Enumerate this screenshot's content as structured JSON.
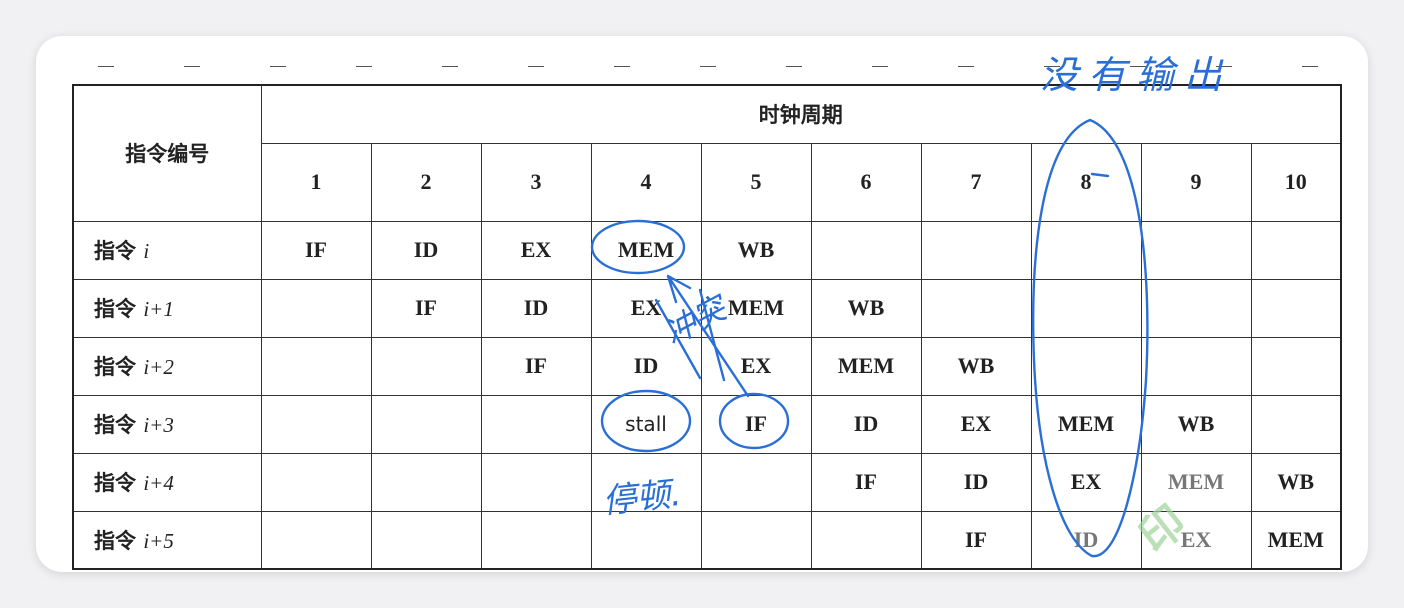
{
  "table": {
    "corner_label": "指令编号",
    "group_label": "时钟周期",
    "cycles": [
      "1",
      "2",
      "3",
      "4",
      "5",
      "6",
      "7",
      "8",
      "9",
      "10"
    ],
    "rows": [
      {
        "label_prefix": "指令 ",
        "label_var": "i",
        "cells": [
          "IF",
          "ID",
          "EX",
          "MEM",
          "WB",
          "",
          "",
          "",
          "",
          ""
        ]
      },
      {
        "label_prefix": "指令 ",
        "label_var": "i+1",
        "cells": [
          "",
          "IF",
          "ID",
          "EX",
          "MEM",
          "WB",
          "",
          "",
          "",
          ""
        ]
      },
      {
        "label_prefix": "指令 ",
        "label_var": "i+2",
        "cells": [
          "",
          "",
          "IF",
          "ID",
          "EX",
          "MEM",
          "WB",
          "",
          "",
          ""
        ]
      },
      {
        "label_prefix": "指令 ",
        "label_var": "i+3",
        "cells": [
          "",
          "",
          "",
          "stall",
          "IF",
          "ID",
          "EX",
          "MEM",
          "WB",
          ""
        ]
      },
      {
        "label_prefix": "指令 ",
        "label_var": "i+4",
        "cells": [
          "",
          "",
          "",
          "",
          "",
          "IF",
          "ID",
          "EX",
          "MEM",
          "WB"
        ]
      },
      {
        "label_prefix": "指令 ",
        "label_var": "i+5",
        "cells": [
          "",
          "",
          "",
          "",
          "",
          "",
          "IF",
          "ID",
          "EX",
          "MEM"
        ]
      }
    ]
  },
  "annotations": {
    "top_right_note": "没有输出",
    "stall_note": "停顿.",
    "middle_note": "冲突"
  },
  "colors": {
    "ink": "#2a6fd6",
    "watermark": "#9fd49a"
  }
}
